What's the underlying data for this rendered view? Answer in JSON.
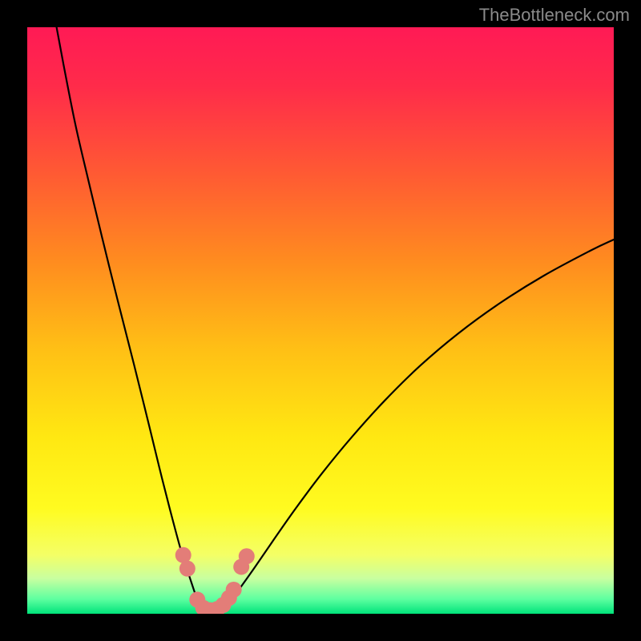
{
  "watermark": "TheBottleneck.com",
  "chart_data": {
    "type": "line",
    "title": "",
    "xlabel": "",
    "ylabel": "",
    "xlim": [
      0,
      100
    ],
    "ylim": [
      0,
      100
    ],
    "gradient_stops": [
      {
        "offset": 0.0,
        "color": "#ff1a55"
      },
      {
        "offset": 0.1,
        "color": "#ff2b4a"
      },
      {
        "offset": 0.25,
        "color": "#ff5a33"
      },
      {
        "offset": 0.4,
        "color": "#ff8c1f"
      },
      {
        "offset": 0.55,
        "color": "#ffc015"
      },
      {
        "offset": 0.7,
        "color": "#ffe812"
      },
      {
        "offset": 0.82,
        "color": "#fffb20"
      },
      {
        "offset": 0.9,
        "color": "#f4ff66"
      },
      {
        "offset": 0.94,
        "color": "#c8ffa0"
      },
      {
        "offset": 0.975,
        "color": "#5effa0"
      },
      {
        "offset": 1.0,
        "color": "#00e37a"
      }
    ],
    "series": [
      {
        "name": "left-branch",
        "x": [
          5,
          6.5,
          8.3,
          10.4,
          12.8,
          15.4,
          18.2,
          20.8,
          23.0,
          24.8,
          26.3,
          27.6,
          28.6,
          29.3,
          29.8
        ],
        "y": [
          100,
          92,
          83,
          74,
          64,
          53.5,
          42.5,
          32,
          23,
          16,
          10.5,
          6.5,
          3.5,
          1.5,
          0.3
        ]
      },
      {
        "name": "right-branch",
        "x": [
          33.2,
          34.2,
          36.0,
          38.5,
          41.8,
          45.8,
          50.3,
          55.4,
          61.0,
          67.0,
          73.5,
          80.5,
          88.0,
          96.0,
          100.0
        ],
        "y": [
          0.3,
          1.6,
          4.0,
          7.5,
          12.3,
          18.0,
          24.0,
          30.2,
          36.4,
          42.3,
          47.8,
          52.9,
          57.6,
          61.9,
          63.8
        ]
      },
      {
        "name": "valley-floor",
        "x": [
          29.8,
          30.8,
          31.8,
          32.8,
          33.2
        ],
        "y": [
          0.3,
          0.0,
          0.0,
          0.0,
          0.3
        ]
      }
    ],
    "dot_markers": {
      "color": "#e37d78",
      "radius_px": 10,
      "points": [
        {
          "x": 26.6,
          "y": 10.0
        },
        {
          "x": 27.3,
          "y": 7.7
        },
        {
          "x": 29.0,
          "y": 2.4
        },
        {
          "x": 30.0,
          "y": 1.0
        },
        {
          "x": 31.2,
          "y": 0.6
        },
        {
          "x": 32.4,
          "y": 0.8
        },
        {
          "x": 33.4,
          "y": 1.5
        },
        {
          "x": 34.4,
          "y": 2.7
        },
        {
          "x": 35.2,
          "y": 4.1
        },
        {
          "x": 36.5,
          "y": 8.0
        },
        {
          "x": 37.4,
          "y": 9.8
        }
      ]
    }
  }
}
